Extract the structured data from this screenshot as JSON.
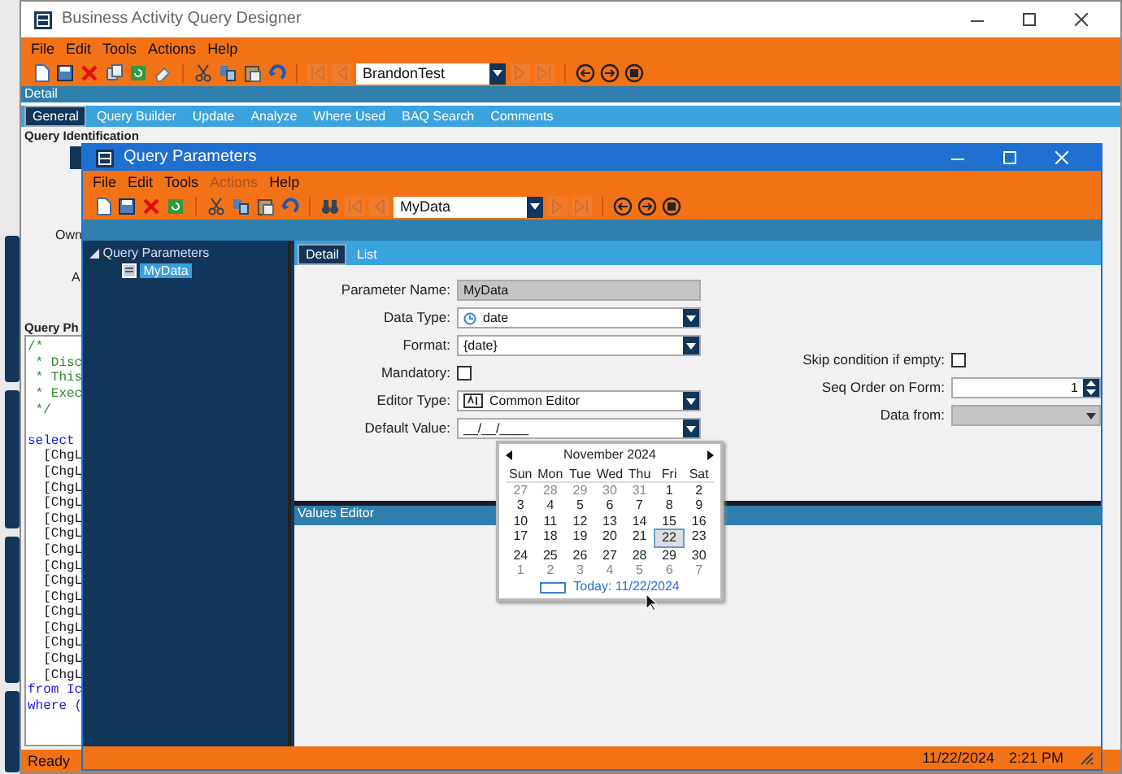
{
  "main_window": {
    "title": "Business Activity Query Designer",
    "menu": [
      {
        "label": "File"
      },
      {
        "label": "Edit"
      },
      {
        "label": "Tools"
      },
      {
        "label": "Actions"
      },
      {
        "label": "Help"
      }
    ],
    "record": "BrandonTest",
    "section_bar": "Detail",
    "tabs": [
      {
        "label": "General",
        "selected": true
      },
      {
        "label": "Query Builder",
        "selected": false
      },
      {
        "label": "Update",
        "selected": false
      },
      {
        "label": "Analyze",
        "selected": false
      },
      {
        "label": "Where Used",
        "selected": false
      },
      {
        "label": "BAQ Search",
        "selected": false
      },
      {
        "label": "Comments",
        "selected": false
      }
    ],
    "group_title": "Query Identification",
    "field_labels": [
      "Own",
      "A"
    ],
    "phrase_title": "Query Ph",
    "code_lines": [
      {
        "text": "/*",
        "kind": "comment"
      },
      {
        "text": " * Disc",
        "kind": "comment"
      },
      {
        "text": " * This",
        "kind": "comment"
      },
      {
        "text": " * Exec",
        "kind": "comment"
      },
      {
        "text": " */",
        "kind": "comment"
      },
      {
        "kind": "blank"
      },
      {
        "text": "select",
        "kind": "keyword"
      },
      {
        "text": "  [ChgL",
        "kind": "plain"
      },
      {
        "text": "  [ChgL",
        "kind": "plain"
      },
      {
        "text": "  [ChgL",
        "kind": "plain"
      },
      {
        "text": "  [ChgL",
        "kind": "plain"
      },
      {
        "text": "  [ChgL",
        "kind": "plain"
      },
      {
        "text": "  [ChgL",
        "kind": "plain"
      },
      {
        "text": "  [ChgL",
        "kind": "plain"
      },
      {
        "text": "  [ChgL",
        "kind": "plain"
      },
      {
        "text": "  [ChgL",
        "kind": "plain"
      },
      {
        "text": "  [ChgL",
        "kind": "plain"
      },
      {
        "text": "  [ChgL",
        "kind": "plain"
      },
      {
        "text": "  [ChgL",
        "kind": "plain"
      },
      {
        "text": "  [ChgL",
        "kind": "plain"
      },
      {
        "text": "  [ChgL",
        "kind": "plain"
      },
      {
        "text": "  [ChgL",
        "kind": "plain"
      },
      {
        "text": "from Ic",
        "kind": "keyword"
      },
      {
        "text": "where (",
        "kind": "keyword"
      }
    ],
    "status": "Ready"
  },
  "dialog": {
    "title": "Query Parameters",
    "menu": [
      {
        "label": "File",
        "disabled": false
      },
      {
        "label": "Edit",
        "disabled": false
      },
      {
        "label": "Tools",
        "disabled": false
      },
      {
        "label": "Actions",
        "disabled": true
      },
      {
        "label": "Help",
        "disabled": false
      }
    ],
    "record": "MyData",
    "tree": {
      "label": "Query Parameters",
      "expanded": true,
      "children": [
        {
          "label": "MyData",
          "selected": true
        }
      ]
    },
    "tabs": [
      {
        "label": "Detail",
        "selected": true
      },
      {
        "label": "List",
        "selected": false
      }
    ],
    "fields": [
      {
        "kind": "text",
        "label": "Parameter Name:",
        "value": "MyData",
        "disabled": true
      },
      {
        "kind": "combo_clock",
        "label": "Data Type:",
        "value": "date"
      },
      {
        "kind": "combo",
        "label": "Format:",
        "value": "{date}"
      },
      {
        "kind": "check",
        "label": "Mandatory:",
        "checked": false
      },
      {
        "kind": "combo_editor",
        "label": "Editor Type:",
        "value": "Common Editor"
      },
      {
        "kind": "combo",
        "label": "Default Value:",
        "value": "__/__/____"
      }
    ],
    "right_fields": [
      {
        "kind": "check",
        "label": "Skip condition if empty:",
        "checked": false
      },
      {
        "kind": "spin",
        "label": "Seq Order on Form:",
        "value": "1"
      },
      {
        "kind": "combo",
        "label": "Data from:",
        "disabled": true
      }
    ],
    "values_editor_title": "Values Editor",
    "status": {
      "date": "11/22/2024",
      "time": "2:21 PM"
    }
  },
  "calendar": {
    "month": "November 2024",
    "weekdays": [
      "Sun",
      "Mon",
      "Tue",
      "Wed",
      "Thu",
      "Fri",
      "Sat"
    ],
    "days": [
      {
        "text": "27",
        "other_month": true,
        "selected": false
      },
      {
        "text": "28",
        "other_month": true,
        "selected": false
      },
      {
        "text": "29",
        "other_month": true,
        "selected": false
      },
      {
        "text": "30",
        "other_month": true,
        "selected": false
      },
      {
        "text": "31",
        "other_month": true,
        "selected": false
      },
      {
        "text": "1",
        "other_month": false,
        "selected": false
      },
      {
        "text": "2",
        "other_month": false,
        "selected": false
      },
      {
        "text": "3",
        "other_month": false,
        "selected": false
      },
      {
        "text": "4",
        "other_month": false,
        "selected": false
      },
      {
        "text": "5",
        "other_month": false,
        "selected": false
      },
      {
        "text": "6",
        "other_month": false,
        "selected": false
      },
      {
        "text": "7",
        "other_month": false,
        "selected": false
      },
      {
        "text": "8",
        "other_month": false,
        "selected": false
      },
      {
        "text": "9",
        "other_month": false,
        "selected": false
      },
      {
        "text": "10",
        "other_month": false,
        "selected": false
      },
      {
        "text": "11",
        "other_month": false,
        "selected": false
      },
      {
        "text": "12",
        "other_month": false,
        "selected": false
      },
      {
        "text": "13",
        "other_month": false,
        "selected": false
      },
      {
        "text": "14",
        "other_month": false,
        "selected": false
      },
      {
        "text": "15",
        "other_month": false,
        "selected": false
      },
      {
        "text": "16",
        "other_month": false,
        "selected": false
      },
      {
        "text": "17",
        "other_month": false,
        "selected": false
      },
      {
        "text": "18",
        "other_month": false,
        "selected": false
      },
      {
        "text": "19",
        "other_month": false,
        "selected": false
      },
      {
        "text": "20",
        "other_month": false,
        "selected": false
      },
      {
        "text": "21",
        "other_month": false,
        "selected": false
      },
      {
        "text": "22",
        "other_month": false,
        "selected": true
      },
      {
        "text": "23",
        "other_month": false,
        "selected": false
      },
      {
        "text": "24",
        "other_month": false,
        "selected": false
      },
      {
        "text": "25",
        "other_month": false,
        "selected": false
      },
      {
        "text": "26",
        "other_month": false,
        "selected": false
      },
      {
        "text": "27",
        "other_month": false,
        "selected": false
      },
      {
        "text": "28",
        "other_month": false,
        "selected": false
      },
      {
        "text": "29",
        "other_month": false,
        "selected": false
      },
      {
        "text": "30",
        "other_month": false,
        "selected": false
      },
      {
        "text": "1",
        "other_month": true,
        "selected": false
      },
      {
        "text": "2",
        "other_month": true,
        "selected": false
      },
      {
        "text": "3",
        "other_month": true,
        "selected": false
      },
      {
        "text": "4",
        "other_month": true,
        "selected": false
      },
      {
        "text": "5",
        "other_month": true,
        "selected": false
      },
      {
        "text": "6",
        "other_month": true,
        "selected": false
      },
      {
        "text": "7",
        "other_month": true,
        "selected": false
      }
    ],
    "today": "Today: 11/22/2024"
  }
}
